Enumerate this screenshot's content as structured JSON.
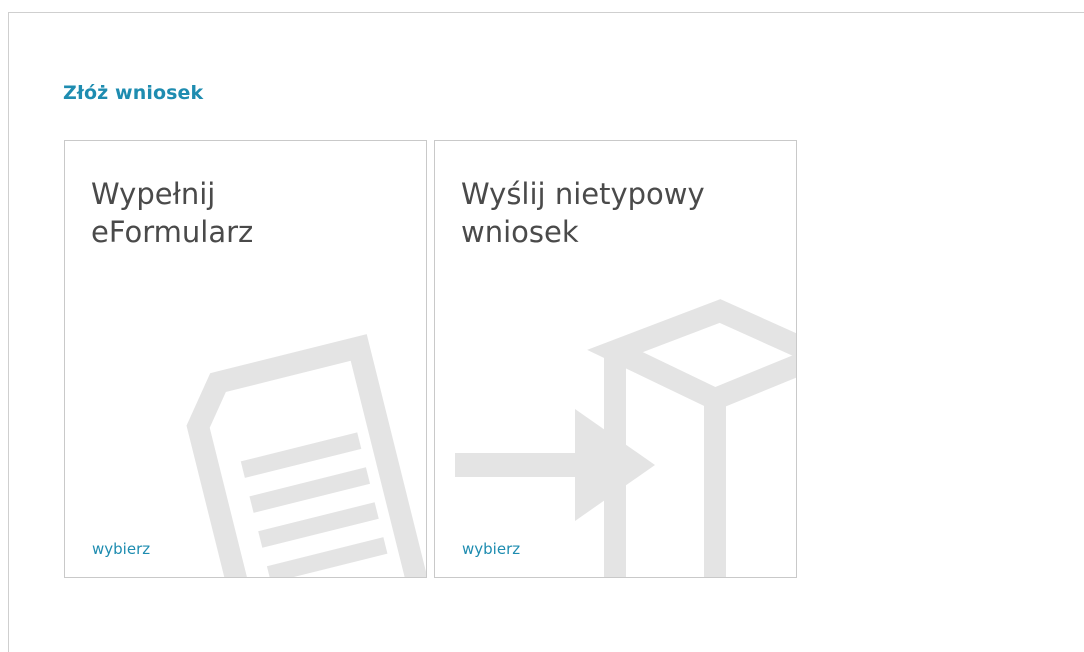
{
  "section": {
    "title": "Złóż wniosek"
  },
  "tiles": [
    {
      "title": "Wypełnij\neFormularz",
      "link_label": "wybierz",
      "icon": "document-icon"
    },
    {
      "title": "Wyślij nietypowy\nwniosek",
      "link_label": "wybierz",
      "icon": "send-box-icon"
    }
  ],
  "colors": {
    "accent": "#1e8cb0",
    "tile_text": "#4a4a4a",
    "tile_border": "#c9c9c9",
    "graphic": "#e4e4e4"
  }
}
